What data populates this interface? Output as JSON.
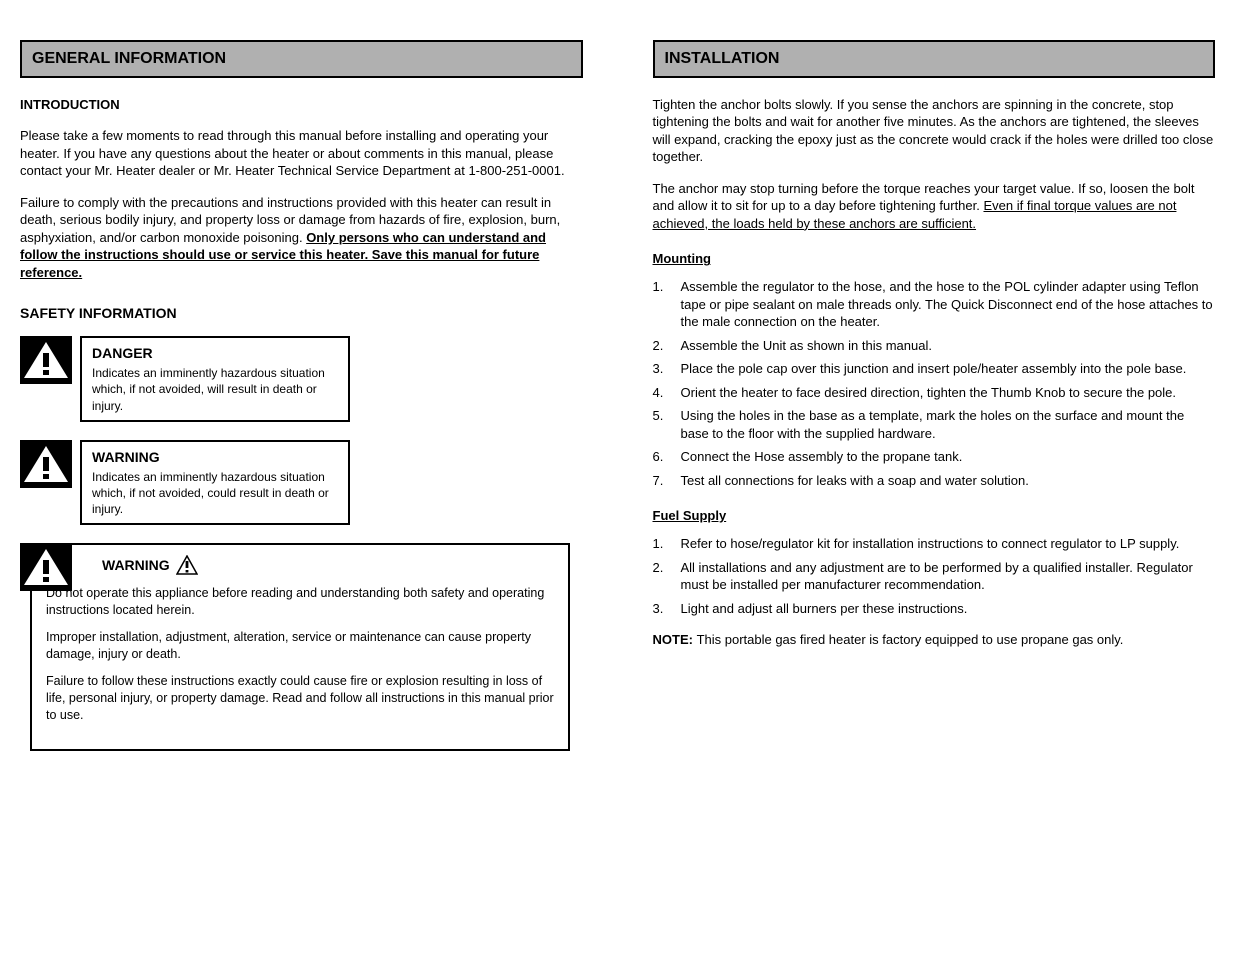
{
  "left": {
    "header": "GENERAL INFORMATION",
    "intro": "INTRODUCTION",
    "p1": "Please take a few moments to read through this manual before installing and operating your heater. If you have any questions about the heater or about comments in this manual, please contact your Mr. Heater dealer or Mr. Heater Technical Service Department at 1-800-251-0001.",
    "p2a": "Failure to comply with the precautions and instructions provided with this heater can result in death, serious bodily injury, and property loss or damage from hazards of fire, explosion, burn, asphyxiation, and/or carbon monoxide poisoning. ",
    "p2b": "Only persons who can understand and follow the instructions should use or service this heater. Save this manual for future reference.",
    "safety": "SAFETY INFORMATION",
    "box1_label": "DANGER",
    "box1_desc": "Indicates an imminently hazardous situation which, if not avoided, will result in death or injury.",
    "box2_label": "WARNING",
    "box2_desc": "Indicates an imminently hazardous situation which, if not avoided, could result in death or injury.",
    "box3_label": "WARNING",
    "box3_p1": "Do not operate this appliance before reading and understanding both safety and operating instructions located herein.",
    "box3_p2": "Improper installation, adjustment, alteration, service or maintenance can cause property damage, injury or death.",
    "box3_p3": "Failure to follow these instructions exactly could cause fire or explosion resulting in loss of life, personal injury, or property damage. Read and follow all instructions in this manual prior to use."
  },
  "right": {
    "header": "INSTALLATION",
    "p1": "Tighten the anchor bolts slowly. If you sense the anchors are spinning in the concrete, stop tightening the bolts and wait for another five minutes. As the anchors are tightened, the sleeves will expand, cracking the epoxy just as the concrete would crack if the holes were drilled too close together.",
    "p2a": "The anchor may stop turning before the torque reaches your target value. If so, loosen the bolt and allow it to sit for up to a day before tightening further. ",
    "p2b": "Even if final torque values are not achieved, the loads held by these anchors are sufficient.",
    "sub1": "Mounting",
    "m1_n": "1.",
    "m1": "Assemble the regulator to the hose, and the hose to the POL cylinder adapter using Teflon tape or pipe sealant on male threads only. The Quick Disconnect end of the hose attaches to the male connection on the heater.",
    "m2_n": "2.",
    "m2": "Assemble the Unit as shown in this manual.",
    "m3_n": "3.",
    "m3": "Place the pole cap over this junction and insert pole/heater assembly into the pole base.",
    "m4_n": "4.",
    "m4": "Orient the heater to face desired direction, tighten the Thumb Knob to secure the pole.",
    "m5_n": "5.",
    "m5": "Using the holes in the base as a template, mark the holes on the surface and mount the base to the floor with the supplied hardware.",
    "m6_n": "6.",
    "m6": "Connect the Hose assembly to the propane tank.",
    "m7_n": "7.",
    "m7": "Test all connections for leaks with a soap and water solution.",
    "sub2": "Fuel Supply",
    "f1_n": "1.",
    "f1": "Refer to hose/regulator kit for installation instructions to connect regulator to LP supply.",
    "f2_n": "2.",
    "f2": "All installations and any adjustment are to be performed by a qualified installer. Regulator must be installed per manufacturer recommendation.",
    "f3_n": "3.",
    "f3": "Light and adjust all burners per these instructions.",
    "note_bold": "NOTE: ",
    "note_text": "This portable gas fired heater is factory equipped to use propane gas only."
  }
}
